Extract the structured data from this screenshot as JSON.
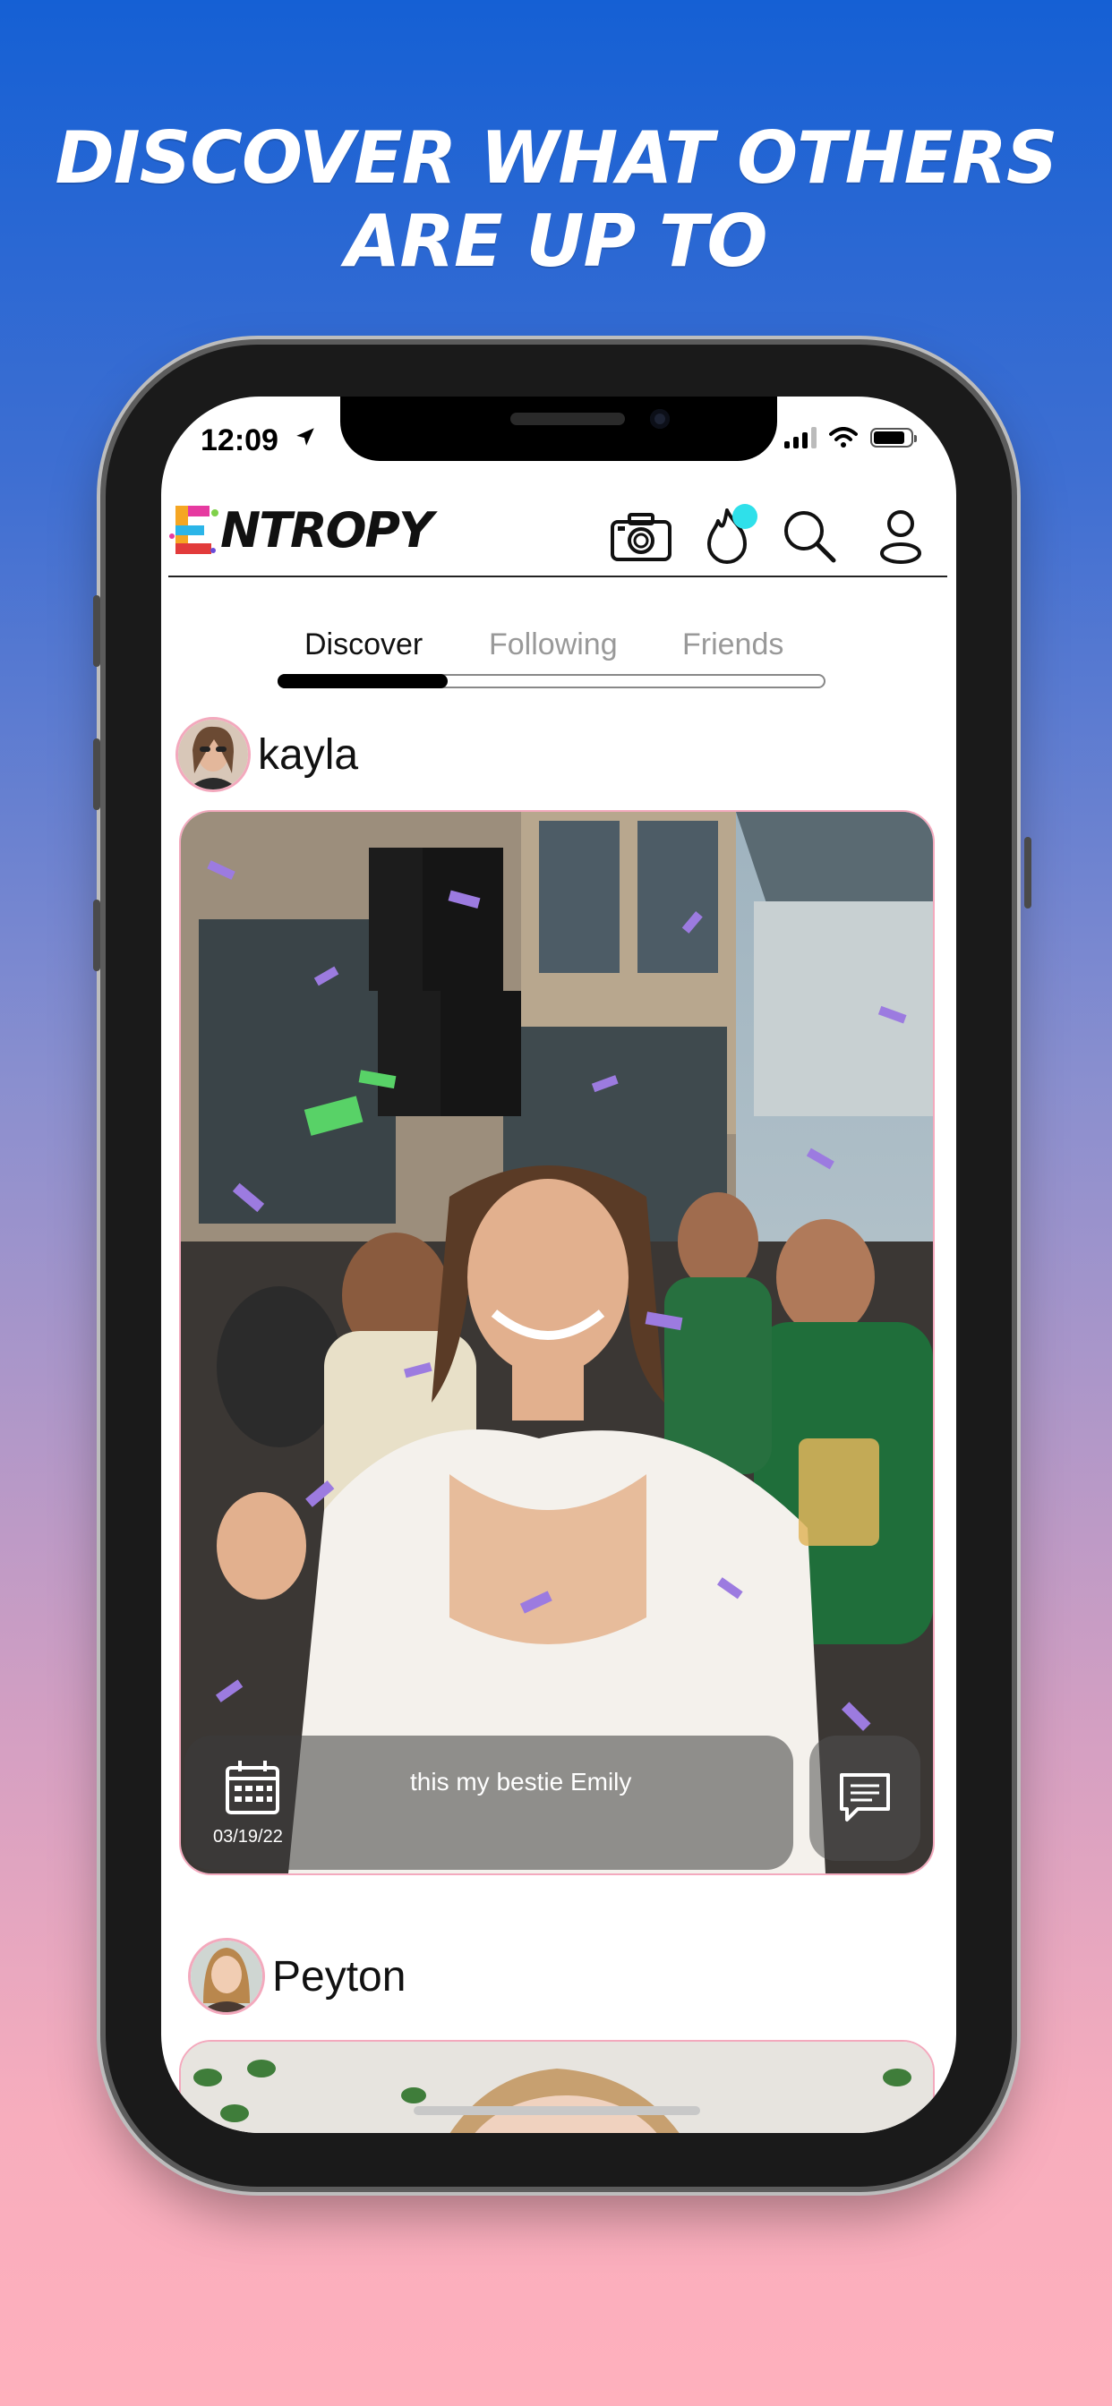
{
  "headline": "DISCOVER WHAT OTHERS ARE UP TO",
  "status_bar": {
    "time": "12:09"
  },
  "app": {
    "logo_text": "NTROPY",
    "icons": [
      "camera-icon",
      "flame-icon",
      "search-icon",
      "profile-icon"
    ],
    "notification_dot_color": "#2fe0ea"
  },
  "tabs": [
    {
      "label": "Discover",
      "active": true
    },
    {
      "label": "Following",
      "active": false
    },
    {
      "label": "Friends",
      "active": false
    }
  ],
  "feed": {
    "posts": [
      {
        "username": "kayla",
        "caption": "this my bestie Emily",
        "date": "03/19/22"
      },
      {
        "username": "Peyton"
      }
    ]
  },
  "colors": {
    "accent_pink": "#f3a9bd",
    "bg_top": "#1560d4",
    "bg_bottom": "#ffb0bd"
  }
}
